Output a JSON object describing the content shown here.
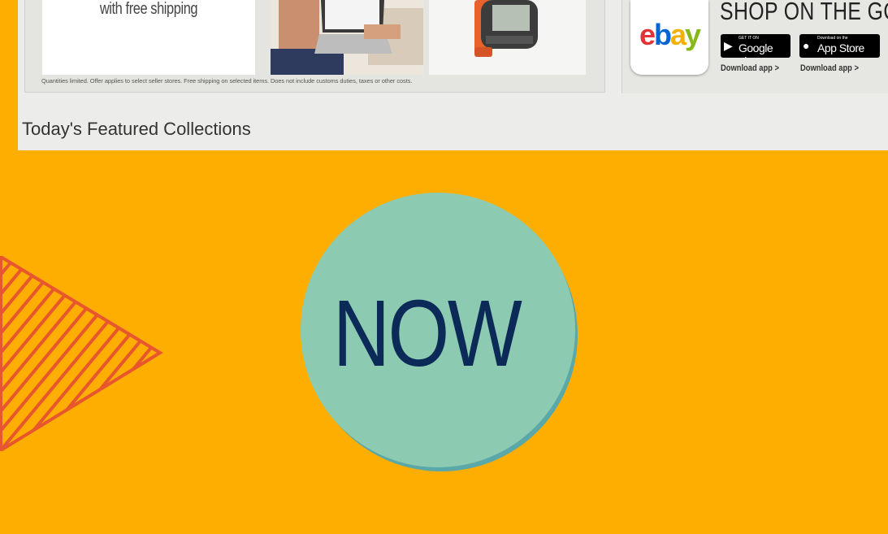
{
  "promo": {
    "shipping_text": "with free shipping",
    "disclaimer": "Quantities limited. Offer applies to select seller stores. Free shipping on selected items. Does not include customs duties, taxes or other costs."
  },
  "app_promo": {
    "title": "SHOP ON THE GO",
    "logo_text": "ebay",
    "google_play": {
      "small": "GET IT ON",
      "label": "Google play"
    },
    "app_store": {
      "small": "Download on the",
      "label": "App Store"
    },
    "google_link": "Download app >",
    "apple_link": "Download app >"
  },
  "section_heading": "Today's Featured Collections",
  "badge": {
    "text": "NOW",
    "fill": "#8CCBB1",
    "shadow": "#5BA8A8",
    "text_color": "#0B2A58"
  },
  "colors": {
    "background": "#FEAE01",
    "stripes": "#E8562E"
  }
}
